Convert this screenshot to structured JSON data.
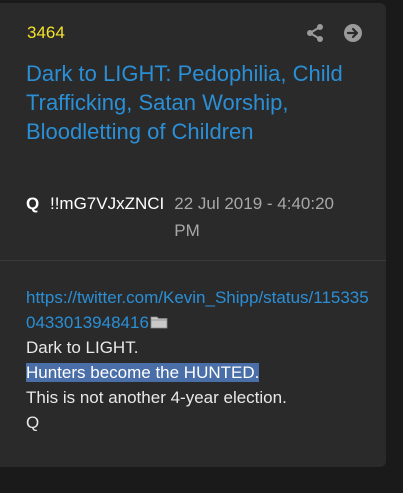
{
  "post": {
    "number": "3464",
    "title": "Dark to LIGHT: Pedophilia, Child Trafficking, Satan Worship, Bloodletting of Children",
    "author": "Q",
    "tripcode": "!!mG7VJxZNCI",
    "timestamp": "22 Jul 2019 - 4:40:20 PM",
    "icons": {
      "share": "share-icon",
      "forward": "arrow-right-circle-icon",
      "folder": "folder-icon"
    },
    "body": {
      "link": "https://twitter.com/Kevin_Shipp/status/1153350433013948416",
      "line1": "Dark to LIGHT.",
      "line2": "Hunters become the HUNTED.",
      "line3": "This is not another 4-year election.",
      "line4": "Q"
    }
  },
  "colors": {
    "background": "#1a1a1a",
    "card": "#2a2a2a",
    "post_number": "#f5e12a",
    "link": "#2b8fd6",
    "highlight": "#4a6ea8"
  }
}
